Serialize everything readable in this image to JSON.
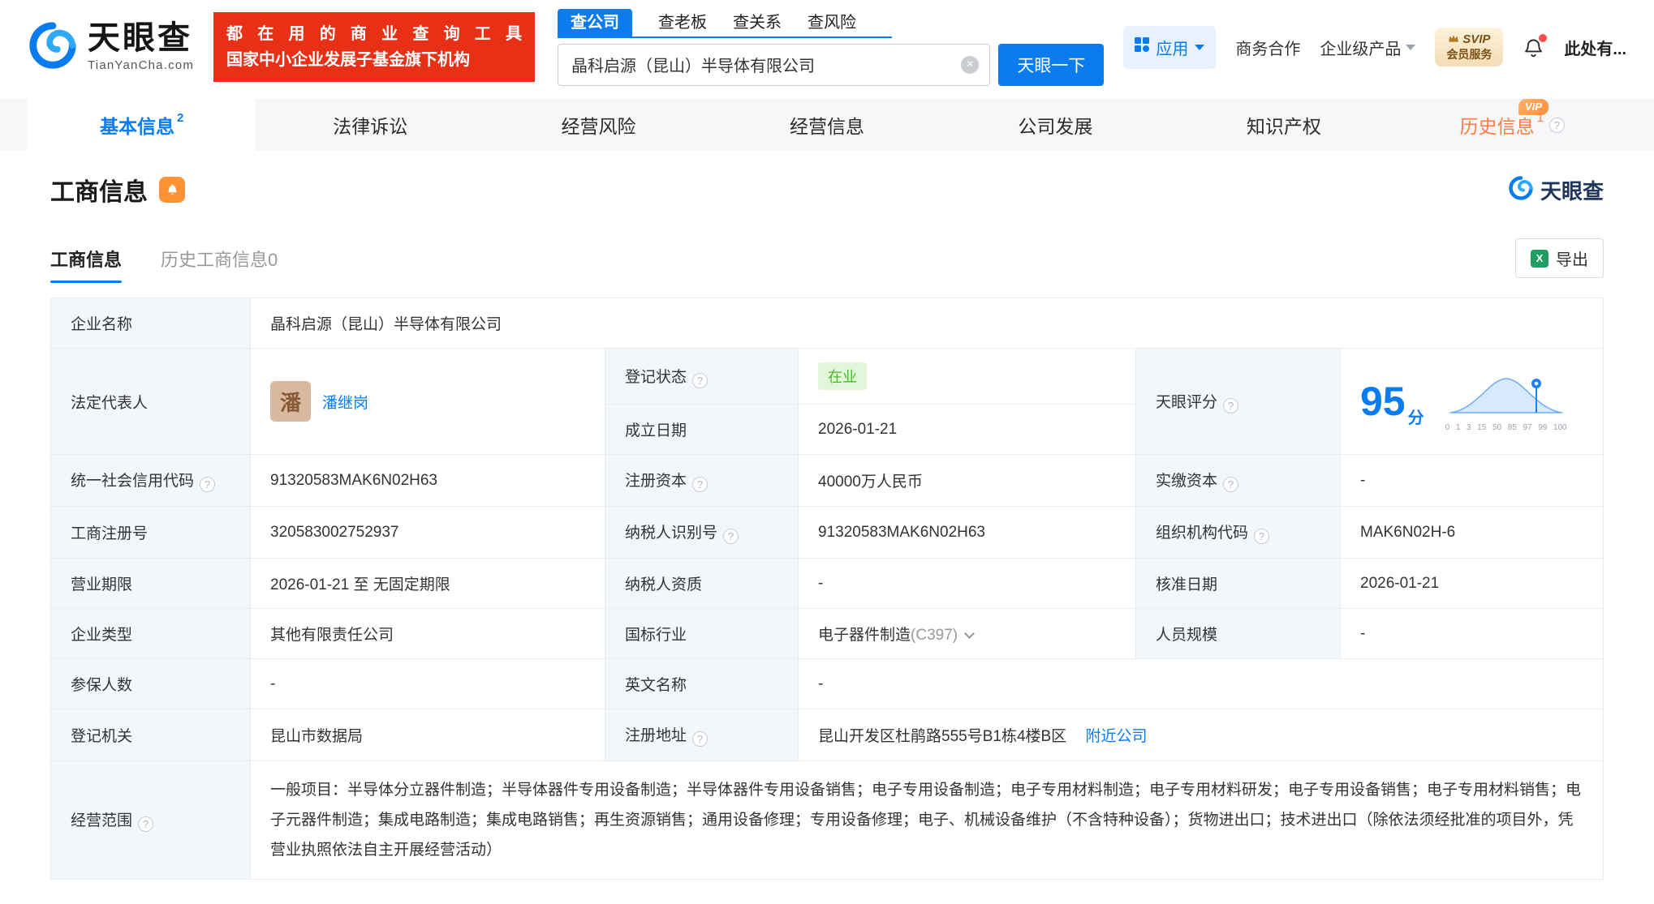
{
  "header": {
    "brand": "天眼查",
    "brand_domain": "TianYanCha.com",
    "promo_line1": "都在用的商业查询工具",
    "promo_line2": "国家中小企业发展子基金旗下机构",
    "search_tabs": [
      {
        "label": "查公司"
      },
      {
        "label": "查老板"
      },
      {
        "label": "查关系"
      },
      {
        "label": "查风险"
      }
    ],
    "search_value": "晶科启源（昆山）半导体有限公司",
    "search_button": "天眼一下",
    "apps_label": "应用",
    "biz_coop": "商务合作",
    "enterprise_products": "企业级产品",
    "svip_top": "SVIP",
    "svip_bottom": "会员服务",
    "user_text": "此处有..."
  },
  "nav_tabs": [
    {
      "label": "基本信息",
      "count": "2"
    },
    {
      "label": "法律诉讼"
    },
    {
      "label": "经营风险"
    },
    {
      "label": "经营信息"
    },
    {
      "label": "公司发展"
    },
    {
      "label": "知识产权"
    },
    {
      "label": "历史信息",
      "count": "1",
      "vip": "VIP"
    }
  ],
  "section": {
    "title": "工商信息",
    "brand": "天眼查",
    "subtab_active": "工商信息",
    "subtab_history": "历史工商信息0",
    "export_label": "导出"
  },
  "info": {
    "labels": {
      "company_name": "企业名称",
      "legal_rep": "法定代表人",
      "reg_status": "登记状态",
      "establish_date": "成立日期",
      "score": "天眼评分",
      "credit_code": "统一社会信用代码",
      "reg_capital": "注册资本",
      "paid_capital": "实缴资本",
      "reg_number": "工商注册号",
      "taxpayer_id": "纳税人识别号",
      "org_code": "组织机构代码",
      "business_term": "营业期限",
      "taxpayer_quality": "纳税人资质",
      "approval_date": "核准日期",
      "company_type": "企业类型",
      "industry": "国标行业",
      "staff_size": "人员规模",
      "insured_count": "参保人数",
      "english_name": "英文名称",
      "reg_authority": "登记机关",
      "reg_address": "注册地址",
      "business_scope": "经营范围"
    },
    "values": {
      "company_name": "晶科启源（昆山）半导体有限公司",
      "legal_rep_avatar": "潘",
      "legal_rep": "潘继岗",
      "reg_status": "在业",
      "establish_date": "2026-01-21",
      "score": "95",
      "score_unit": "分",
      "credit_code": "91320583MAK6N02H63",
      "reg_capital": "40000万人民币",
      "paid_capital": "-",
      "reg_number": "320583002752937",
      "taxpayer_id": "91320583MAK6N02H63",
      "org_code": "MAK6N02H-6",
      "business_term": "2026-01-21 至 无固定期限",
      "taxpayer_quality": "-",
      "approval_date": "2026-01-21",
      "company_type": "其他有限责任公司",
      "industry": "电子器件制造",
      "industry_code": "(C397)",
      "staff_size": "-",
      "insured_count": "-",
      "english_name": "-",
      "reg_authority": "昆山市数据局",
      "reg_address": "昆山开发区杜鹃路555号B1栋4楼B区",
      "nearby_link": "附近公司",
      "business_scope": "一般项目：半导体分立器件制造；半导体器件专用设备制造；半导体器件专用设备销售；电子专用设备制造；电子专用材料制造；电子专用材料研发；电子专用设备销售；电子专用材料销售；电子元器件制造；集成电路制造；集成电路销售；再生资源销售；通用设备修理；专用设备修理；电子、机械设备维护（不含特种设备）；货物进出口；技术进出口（除依法须经批准的项目外，凭营业执照依法自主开展经营活动）"
    },
    "score_axis": [
      "0",
      "1",
      "3",
      "15",
      "50",
      "85",
      "97",
      "99",
      "100"
    ]
  }
}
